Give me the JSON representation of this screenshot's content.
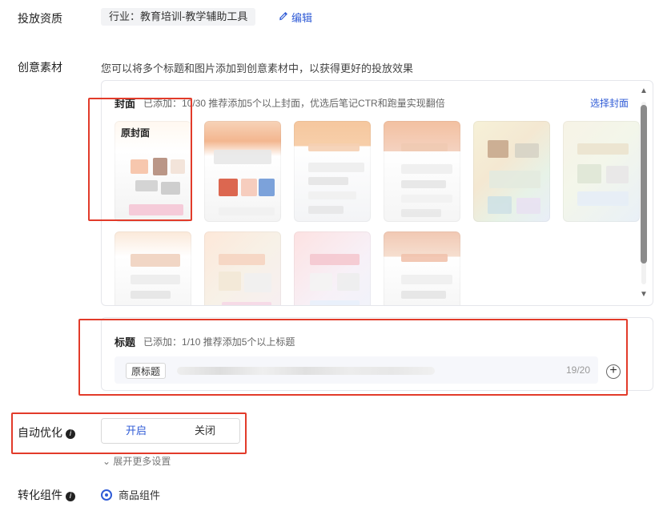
{
  "labels": {
    "placement_qualification": "投放资质",
    "creative_material": "创意素材",
    "auto_optimize": "自动优化",
    "conversion_component": "转化组件"
  },
  "qualification": {
    "industry_tag": "行业：教育培训-教学辅助工具",
    "edit_label": "编辑"
  },
  "creative": {
    "description": "您可以将多个标题和图片添加到创意素材中，以获得更好的投放效果",
    "cover": {
      "title": "封面",
      "hint": "已添加：10/30 推荐添加5个以上封面，优选后笔记CTR和跑量实现翻倍",
      "choose_label": "选择封面",
      "covers": [
        {
          "caption": "原封面"
        },
        {
          "caption": ""
        },
        {
          "caption": ""
        },
        {
          "caption": ""
        },
        {
          "caption": ""
        },
        {
          "caption": ""
        },
        {
          "caption": ""
        },
        {
          "caption": ""
        },
        {
          "caption": ""
        },
        {
          "caption": ""
        }
      ]
    },
    "titles": {
      "title": "标题",
      "hint": "已添加：1/10 推荐添加5个以上标题",
      "original_label": "原标题",
      "count": "19/20"
    }
  },
  "auto_optimize": {
    "on": "开启",
    "off": "关闭",
    "selected": "开启"
  },
  "more_settings": "展开更多设置",
  "conversion": {
    "option": "商品组件"
  }
}
